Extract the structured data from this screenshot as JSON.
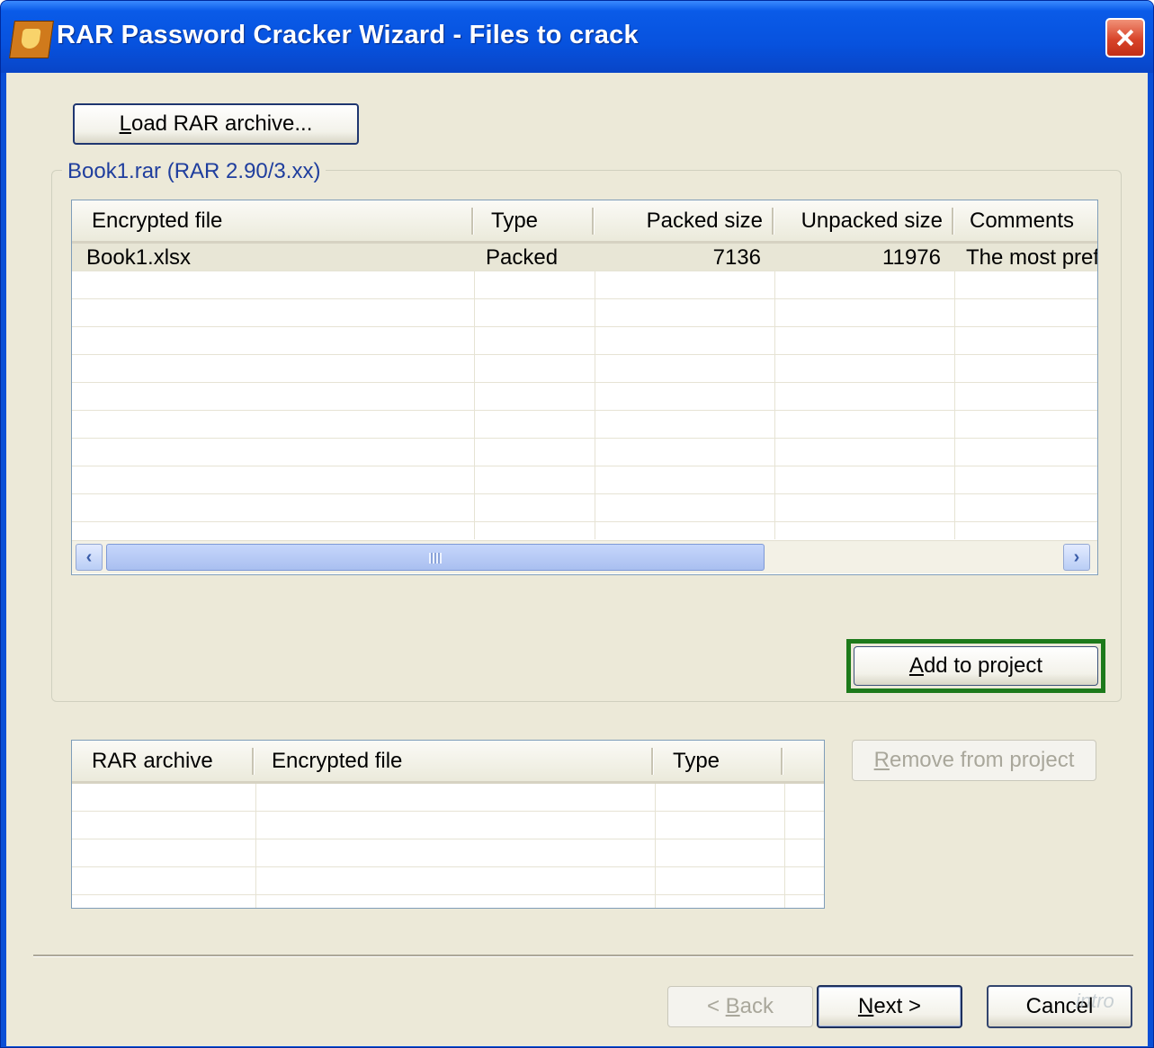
{
  "window": {
    "title": "RAR Password Cracker Wizard - Files to crack"
  },
  "load_button": {
    "label_accel": "L",
    "label_rest": "oad RAR archive..."
  },
  "archive_group": {
    "legend": "Book1.rar (RAR 2.90/3.xx)",
    "columns": [
      "Encrypted file",
      "Type",
      "Packed size",
      "Unpacked size",
      "Comments"
    ],
    "rows": [
      {
        "file": "Book1.xlsx",
        "type": "Packed",
        "packed": "7136",
        "unpacked": "11976",
        "comments": "The most pref"
      }
    ]
  },
  "add_button": {
    "label_accel": "A",
    "label_rest": "dd to project"
  },
  "project_list": {
    "columns": [
      "RAR archive",
      "Encrypted file",
      "Type"
    ]
  },
  "remove_button": {
    "label_accel": "R",
    "label_rest": "emove from project"
  },
  "footer": {
    "back_prefix": "< ",
    "back_accel": "B",
    "back_rest": "ack",
    "next_accel": "N",
    "next_rest": "ext >",
    "cancel_label": "Cancel"
  },
  "watermark": "intro"
}
